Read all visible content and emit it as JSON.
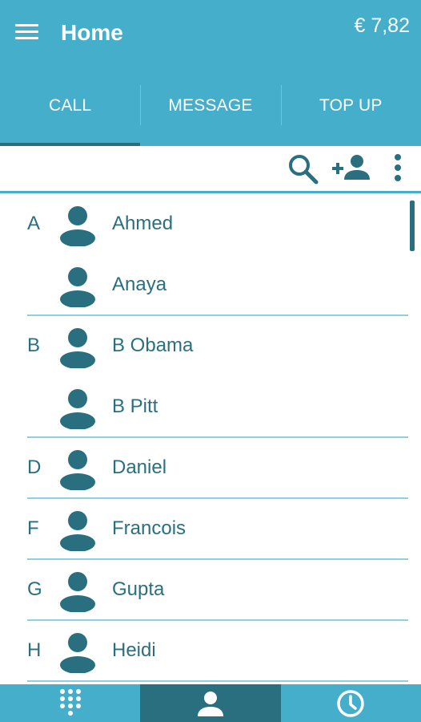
{
  "header": {
    "title": "Home",
    "balance": "€ 7,82"
  },
  "tabs": [
    {
      "label": "CALL",
      "active": true
    },
    {
      "label": "MESSAGE",
      "active": false
    },
    {
      "label": "TOP UP",
      "active": false
    }
  ],
  "toolbar": {
    "icons": [
      "search-icon",
      "add-contact-icon",
      "more-vert-icon"
    ]
  },
  "contacts": [
    {
      "letter": "A",
      "name": "Ahmed"
    },
    {
      "letter": "",
      "name": "Anaya"
    },
    {
      "letter": "B",
      "name": "B Obama"
    },
    {
      "letter": "",
      "name": "B Pitt"
    },
    {
      "letter": "D",
      "name": "Daniel"
    },
    {
      "letter": "F",
      "name": "Francois"
    },
    {
      "letter": "G",
      "name": "Gupta"
    },
    {
      "letter": "H",
      "name": "Heidi"
    }
  ],
  "bottom_nav": [
    {
      "icon": "dialpad-icon",
      "active": false
    },
    {
      "icon": "contacts-icon",
      "active": true
    },
    {
      "icon": "clock-icon",
      "active": false
    }
  ],
  "colors": {
    "primary": "#44aecb",
    "dark_teal": "#2a6f7f",
    "divider": "#8fcfe0",
    "background": "#ffffff"
  }
}
